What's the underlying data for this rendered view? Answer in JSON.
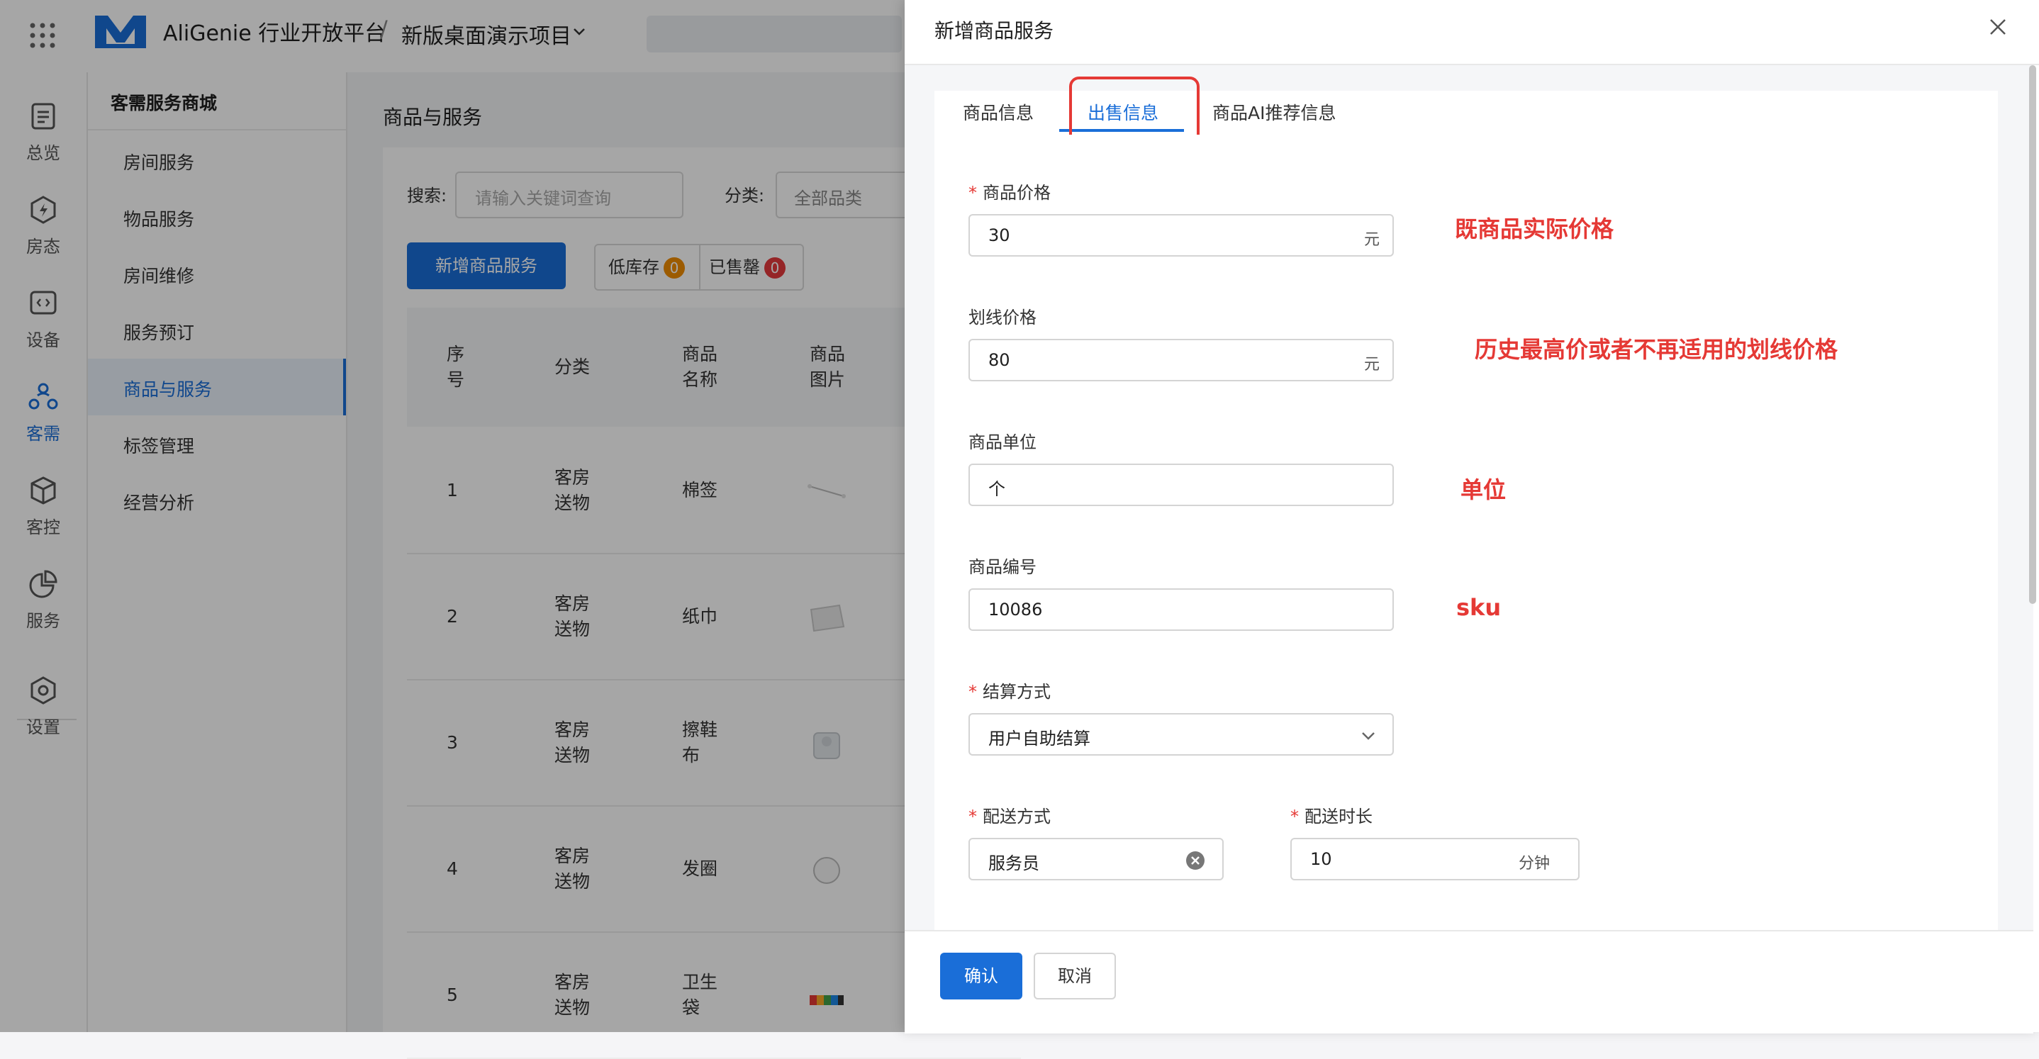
{
  "header": {
    "brand": "AliGenie 行业开放平台",
    "separator": "/",
    "project": "新版桌面演示项目"
  },
  "rail": {
    "items": [
      {
        "label": "总览",
        "icon": "dashboard-icon"
      },
      {
        "label": "房态",
        "icon": "house-icon"
      },
      {
        "label": "设备",
        "icon": "device-icon"
      },
      {
        "label": "客需",
        "icon": "guest-demand-icon",
        "active": true
      },
      {
        "label": "客控",
        "icon": "cube-icon"
      },
      {
        "label": "服务",
        "icon": "pie-chart-icon"
      },
      {
        "label": "设置",
        "icon": "settings-icon"
      }
    ]
  },
  "subnav": {
    "title": "客需服务商城",
    "items": [
      {
        "label": "房间服务"
      },
      {
        "label": "物品服务"
      },
      {
        "label": "房间维修"
      },
      {
        "label": "服务预订"
      },
      {
        "label": "商品与服务",
        "active": true
      },
      {
        "label": "标签管理"
      },
      {
        "label": "经营分析"
      }
    ]
  },
  "main": {
    "title": "商品与服务",
    "search_label": "搜索:",
    "search_placeholder": "请输入关键词查询",
    "category_label": "分类:",
    "category_value": "全部品类",
    "add_button": "新增商品服务",
    "low_stock_label": "低库存",
    "low_stock_count": "0",
    "sold_out_label": "已售罄",
    "sold_out_count": "0",
    "columns": [
      {
        "line1": "序",
        "line2": "号"
      },
      {
        "line1": "分类",
        "line2": ""
      },
      {
        "line1": "商品",
        "line2": "名称"
      },
      {
        "line1": "商品",
        "line2": "图片"
      }
    ],
    "rows": [
      {
        "index": "1",
        "cat1": "客房",
        "cat2": "送物",
        "name1": "棉签",
        "name2": ""
      },
      {
        "index": "2",
        "cat1": "客房",
        "cat2": "送物",
        "name1": "纸巾",
        "name2": ""
      },
      {
        "index": "3",
        "cat1": "客房",
        "cat2": "送物",
        "name1": "擦鞋",
        "name2": "布"
      },
      {
        "index": "4",
        "cat1": "客房",
        "cat2": "送物",
        "name1": "发圈",
        "name2": ""
      },
      {
        "index": "5",
        "cat1": "客房",
        "cat2": "送物",
        "name1": "卫生",
        "name2": "袋"
      }
    ]
  },
  "drawer": {
    "title": "新增商品服务",
    "tabs": [
      {
        "label": "商品信息"
      },
      {
        "label": "出售信息",
        "active": true
      },
      {
        "label": "商品AI推荐信息"
      }
    ],
    "form": {
      "price": {
        "label": "商品价格",
        "required_mark": "*",
        "value": "30",
        "suffix": "元"
      },
      "strike_price": {
        "label": "划线价格",
        "value": "80",
        "suffix": "元"
      },
      "unit": {
        "label": "商品单位",
        "value": "个"
      },
      "sku": {
        "label": "商品编号",
        "value": "10086"
      },
      "settlement": {
        "label": "结算方式",
        "required_mark": "*",
        "value": "用户自助结算"
      },
      "delivery_method": {
        "label": "配送方式",
        "required_mark": "*",
        "value": "服务员"
      },
      "delivery_time": {
        "label": "配送时长",
        "required_mark": "*",
        "value": "10",
        "suffix": "分钟"
      }
    },
    "annotations": {
      "price_note": "既商品实际价格",
      "strike_note": "历史最高价或者不再适用的划线价格",
      "unit_note": "单位",
      "sku_note": "sku"
    },
    "confirm": "确认",
    "cancel": "取消"
  },
  "colors": {
    "accent": "#1a6ed8",
    "annotation": "#e53935",
    "badge_orange": "#f08c00",
    "badge_red": "#e5393d"
  }
}
